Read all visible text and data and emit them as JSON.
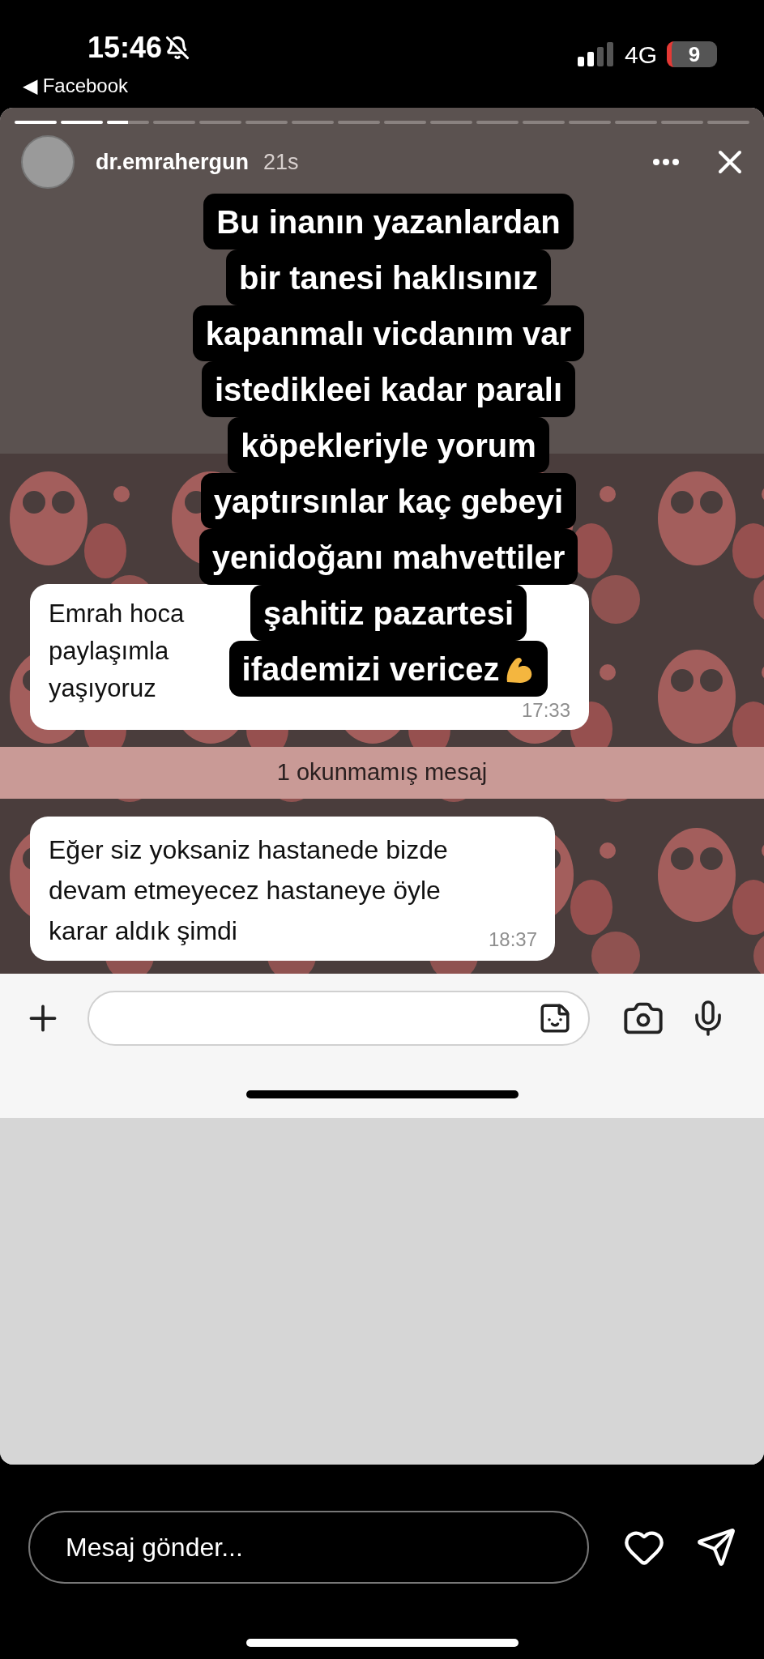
{
  "status_bar": {
    "time": "15:46",
    "back_label": "◀ Facebook",
    "network": "4G",
    "battery": "9"
  },
  "story": {
    "progress": [
      {
        "level": 1
      },
      {
        "level": 1
      },
      {
        "level": 0.5
      },
      {
        "level": 0
      },
      {
        "level": 0
      },
      {
        "level": 0
      },
      {
        "level": 0
      },
      {
        "level": 0
      },
      {
        "level": 0
      },
      {
        "level": 0
      },
      {
        "level": 0
      },
      {
        "level": 0
      },
      {
        "level": 0
      },
      {
        "level": 0
      },
      {
        "level": 0
      },
      {
        "level": 0
      }
    ],
    "username": "dr.emrahergun",
    "age": "21s",
    "caption_lines": [
      "Bu inanın yazanlardan",
      "bir tanesi haklısınız",
      "kapanmalı vicdanım var",
      "istedikleei kadar paralı",
      "köpekleriyle yorum",
      "yaptırsınlar kaç gebeyi",
      "yenidoğanı mahvettiler",
      "şahitiz pazartesi",
      "ifademizi vericez"
    ],
    "chat": {
      "first_message": {
        "lines": [
          "Emrah hoca",
          "paylaşımla",
          "yaşıyoruz"
        ],
        "time": "17:33"
      },
      "unread_divider": "1 okunmamış mesaj",
      "second_message": {
        "text": "Eğer siz yoksaniz hastanede bizde devam etmeyecez hastaneye öyle karar aldık şimdi",
        "time": "18:37"
      }
    }
  },
  "reply": {
    "placeholder": "Mesaj gönder..."
  }
}
